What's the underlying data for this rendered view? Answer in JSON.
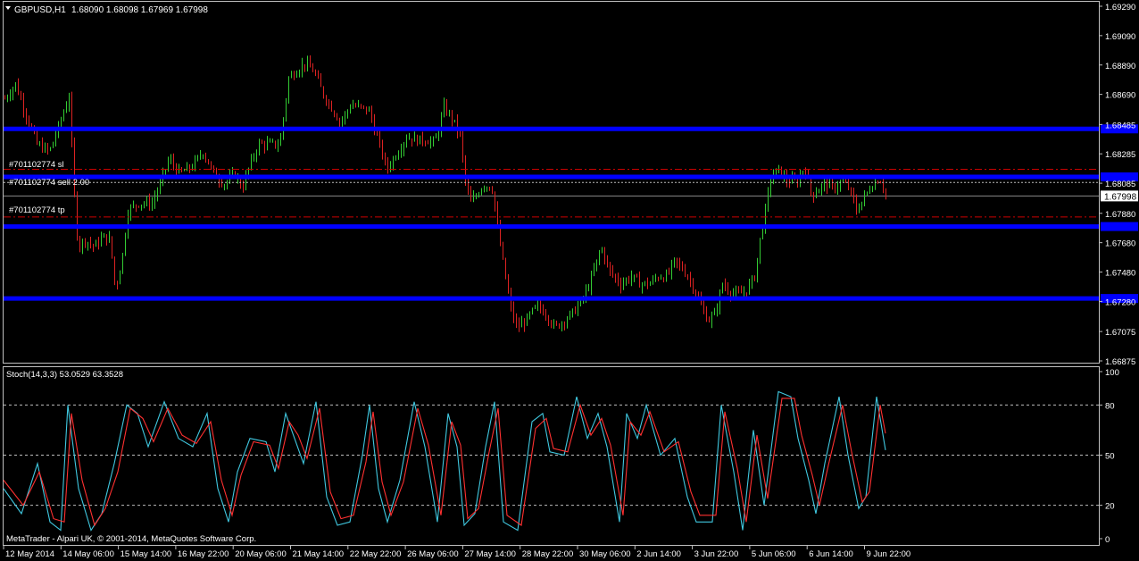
{
  "header": {
    "symbol": "GBPUSD,H1",
    "ohlc": "1.68090 1.68098 1.67969 1.67998",
    "dropdown_icon": "triangle-down-icon"
  },
  "colors": {
    "background": "#000000",
    "frame": "#c0c0c0",
    "bull": "#33cc33",
    "bear": "#dd2222",
    "level": "#0000ff",
    "trade": "#cc0000",
    "stoch_main": "#40c8e0",
    "stoch_signal": "#ff3030",
    "text": "#ffffff"
  },
  "price_axis": {
    "ticks": [
      "1.69290",
      "1.69090",
      "1.68890",
      "1.68690",
      "1.68485",
      "1.68285",
      "1.68085",
      "1.67880",
      "1.67680",
      "1.67480",
      "1.67280",
      "1.67075",
      "1.66875"
    ],
    "current_price": "1.67998"
  },
  "time_axis": {
    "labels": [
      "12 May 2014",
      "14 May 06:00",
      "15 May 14:00",
      "16 May 22:00",
      "20 May 06:00",
      "21 May 14:00",
      "22 May 22:00",
      "26 May 06:00",
      "27 May 14:00",
      "28 May 22:00",
      "30 May 06:00",
      "2 Jun 14:00",
      "3 Jun 22:00",
      "5 Jun 06:00",
      "6 Jun 14:00",
      "9 Jun 22:00"
    ]
  },
  "trade_labels": {
    "sl": "#701102774 sl",
    "sell": "#701102774 sell 2.00",
    "tp": "#701102774 tp"
  },
  "indicator": {
    "label": "Stoch(14,3,3) 53.0529 63.3528",
    "ticks": [
      "100",
      "80",
      "50",
      "20",
      "0"
    ]
  },
  "footer": {
    "copyright": "MetaTrader - Alpari UK, © 2001-2014, MetaQuotes Software Corp."
  },
  "chart_data": [
    {
      "type": "candlestick",
      "ylim": [
        1.66875,
        1.6929
      ],
      "horizontal_levels": [
        1.68455,
        1.68128,
        1.6779,
        1.673
      ],
      "trade_levels": {
        "sl": 1.6818,
        "sell": 1.6809,
        "tp": 1.67855
      },
      "close_path": [
        [
          0,
          1.6866
        ],
        [
          12,
          1.6876
        ],
        [
          24,
          1.6855
        ],
        [
          36,
          1.6835
        ],
        [
          50,
          1.683
        ],
        [
          62,
          1.685
        ],
        [
          72,
          1.6868
        ],
        [
          78,
          1.68
        ],
        [
          82,
          1.6765
        ],
        [
          90,
          1.677
        ],
        [
          100,
          1.6765
        ],
        [
          110,
          1.6772
        ],
        [
          118,
          1.677
        ],
        [
          124,
          1.6735
        ],
        [
          132,
          1.676
        ],
        [
          138,
          1.679
        ],
        [
          150,
          1.6795
        ],
        [
          165,
          1.6795
        ],
        [
          175,
          1.681
        ],
        [
          184,
          1.6825
        ],
        [
          196,
          1.6815
        ],
        [
          210,
          1.682
        ],
        [
          222,
          1.683
        ],
        [
          234,
          1.6815
        ],
        [
          246,
          1.6808
        ],
        [
          258,
          1.6815
        ],
        [
          266,
          1.6805
        ],
        [
          274,
          1.682
        ],
        [
          284,
          1.6835
        ],
        [
          296,
          1.6835
        ],
        [
          308,
          1.6835
        ],
        [
          318,
          1.688
        ],
        [
          326,
          1.6885
        ],
        [
          336,
          1.689
        ],
        [
          346,
          1.6885
        ],
        [
          356,
          1.687
        ],
        [
          366,
          1.686
        ],
        [
          376,
          1.685
        ],
        [
          388,
          1.6862
        ],
        [
          398,
          1.686
        ],
        [
          408,
          1.6858
        ],
        [
          418,
          1.6838
        ],
        [
          428,
          1.6818
        ],
        [
          438,
          1.6828
        ],
        [
          450,
          1.684
        ],
        [
          462,
          1.6838
        ],
        [
          472,
          1.6838
        ],
        [
          482,
          1.6836
        ],
        [
          492,
          1.686
        ],
        [
          502,
          1.6852
        ],
        [
          510,
          1.684
        ],
        [
          516,
          1.681
        ],
        [
          522,
          1.6795
        ],
        [
          528,
          1.68
        ],
        [
          536,
          1.6808
        ],
        [
          546,
          1.6805
        ],
        [
          554,
          1.677
        ],
        [
          562,
          1.674
        ],
        [
          568,
          1.672
        ],
        [
          574,
          1.671
        ],
        [
          584,
          1.6715
        ],
        [
          596,
          1.6725
        ],
        [
          606,
          1.672
        ],
        [
          616,
          1.671
        ],
        [
          626,
          1.6715
        ],
        [
          636,
          1.672
        ],
        [
          648,
          1.673
        ],
        [
          658,
          1.6745
        ],
        [
          668,
          1.6765
        ],
        [
          678,
          1.6748
        ],
        [
          690,
          1.674
        ],
        [
          702,
          1.6745
        ],
        [
          712,
          1.674
        ],
        [
          722,
          1.674
        ],
        [
          732,
          1.6745
        ],
        [
          742,
          1.6745
        ],
        [
          750,
          1.6755
        ],
        [
          760,
          1.675
        ],
        [
          770,
          1.674
        ],
        [
          780,
          1.6725
        ],
        [
          788,
          1.6715
        ],
        [
          796,
          1.672
        ],
        [
          804,
          1.674
        ],
        [
          812,
          1.6735
        ],
        [
          820,
          1.6732
        ],
        [
          830,
          1.6735
        ],
        [
          840,
          1.6745
        ],
        [
          846,
          1.677
        ],
        [
          852,
          1.679
        ],
        [
          858,
          1.6812
        ],
        [
          866,
          1.6818
        ],
        [
          876,
          1.681
        ],
        [
          888,
          1.681
        ],
        [
          896,
          1.682
        ],
        [
          904,
          1.68
        ],
        [
          912,
          1.6805
        ],
        [
          920,
          1.6808
        ],
        [
          928,
          1.6805
        ],
        [
          938,
          1.681
        ],
        [
          946,
          1.6805
        ],
        [
          954,
          1.679
        ],
        [
          962,
          1.6798
        ],
        [
          972,
          1.6808
        ],
        [
          980,
          1.6812
        ],
        [
          988,
          1.68
        ]
      ]
    },
    {
      "type": "line",
      "title": "Stoch(14,3,3)",
      "ylim": [
        0,
        100
      ],
      "levels": [
        80,
        50,
        20
      ],
      "series": [
        {
          "name": "main",
          "last": 53.0529,
          "points": [
            [
              0,
              30
            ],
            [
              20,
              15
            ],
            [
              38,
              45
            ],
            [
              52,
              10
            ],
            [
              64,
              5
            ],
            [
              72,
              80
            ],
            [
              84,
              30
            ],
            [
              98,
              5
            ],
            [
              110,
              15
            ],
            [
              124,
              45
            ],
            [
              138,
              80
            ],
            [
              150,
              75
            ],
            [
              162,
              55
            ],
            [
              180,
              82
            ],
            [
              196,
              60
            ],
            [
              212,
              55
            ],
            [
              228,
              75
            ],
            [
              240,
              30
            ],
            [
              252,
              10
            ],
            [
              262,
              40
            ],
            [
              276,
              60
            ],
            [
              294,
              58
            ],
            [
              304,
              40
            ],
            [
              316,
              75
            ],
            [
              326,
              60
            ],
            [
              336,
              45
            ],
            [
              350,
              82
            ],
            [
              362,
              25
            ],
            [
              374,
              8
            ],
            [
              388,
              10
            ],
            [
              402,
              50
            ],
            [
              410,
              80
            ],
            [
              420,
              30
            ],
            [
              430,
              10
            ],
            [
              444,
              35
            ],
            [
              460,
              82
            ],
            [
              472,
              55
            ],
            [
              486,
              10
            ],
            [
              498,
              75
            ],
            [
              508,
              55
            ],
            [
              516,
              8
            ],
            [
              528,
              15
            ],
            [
              540,
              55
            ],
            [
              550,
              82
            ],
            [
              560,
              10
            ],
            [
              576,
              5
            ],
            [
              592,
              70
            ],
            [
              604,
              75
            ],
            [
              612,
              52
            ],
            [
              628,
              50
            ],
            [
              642,
              85
            ],
            [
              654,
              60
            ],
            [
              666,
              75
            ],
            [
              676,
              55
            ],
            [
              690,
              10
            ],
            [
              698,
              75
            ],
            [
              710,
              60
            ],
            [
              720,
              80
            ],
            [
              736,
              50
            ],
            [
              752,
              60
            ],
            [
              766,
              25
            ],
            [
              776,
              10
            ],
            [
              794,
              10
            ],
            [
              804,
              80
            ],
            [
              818,
              40
            ],
            [
              828,
              5
            ],
            [
              840,
              65
            ],
            [
              852,
              20
            ],
            [
              868,
              88
            ],
            [
              882,
              85
            ],
            [
              890,
              60
            ],
            [
              902,
              35
            ],
            [
              910,
              15
            ],
            [
              920,
              45
            ],
            [
              936,
              85
            ],
            [
              946,
              50
            ],
            [
              958,
              18
            ],
            [
              966,
              25
            ],
            [
              978,
              85
            ],
            [
              988,
              53
            ]
          ]
        },
        {
          "name": "signal",
          "last": 63.3528,
          "points": [
            [
              0,
              35
            ],
            [
              22,
              20
            ],
            [
              40,
              40
            ],
            [
              56,
              12
            ],
            [
              68,
              10
            ],
            [
              76,
              75
            ],
            [
              88,
              35
            ],
            [
              102,
              8
            ],
            [
              114,
              18
            ],
            [
              128,
              40
            ],
            [
              142,
              78
            ],
            [
              156,
              72
            ],
            [
              168,
              58
            ],
            [
              184,
              78
            ],
            [
              200,
              62
            ],
            [
              216,
              57
            ],
            [
              232,
              70
            ],
            [
              244,
              35
            ],
            [
              256,
              14
            ],
            [
              266,
              38
            ],
            [
              280,
              58
            ],
            [
              298,
              56
            ],
            [
              308,
              42
            ],
            [
              320,
              70
            ],
            [
              330,
              62
            ],
            [
              340,
              48
            ],
            [
              354,
              78
            ],
            [
              366,
              28
            ],
            [
              378,
              12
            ],
            [
              392,
              14
            ],
            [
              406,
              46
            ],
            [
              414,
              76
            ],
            [
              424,
              34
            ],
            [
              434,
              14
            ],
            [
              448,
              34
            ],
            [
              464,
              78
            ],
            [
              476,
              56
            ],
            [
              490,
              14
            ],
            [
              502,
              70
            ],
            [
              512,
              56
            ],
            [
              520,
              12
            ],
            [
              532,
              18
            ],
            [
              544,
              52
            ],
            [
              554,
              78
            ],
            [
              564,
              14
            ],
            [
              580,
              8
            ],
            [
              596,
              66
            ],
            [
              608,
              72
            ],
            [
              616,
              54
            ],
            [
              632,
              52
            ],
            [
              646,
              80
            ],
            [
              658,
              62
            ],
            [
              670,
              72
            ],
            [
              680,
              56
            ],
            [
              694,
              14
            ],
            [
              702,
              70
            ],
            [
              714,
              62
            ],
            [
              724,
              76
            ],
            [
              740,
              52
            ],
            [
              756,
              58
            ],
            [
              770,
              28
            ],
            [
              780,
              14
            ],
            [
              798,
              14
            ],
            [
              808,
              76
            ],
            [
              822,
              42
            ],
            [
              832,
              10
            ],
            [
              844,
              62
            ],
            [
              856,
              24
            ],
            [
              872,
              84
            ],
            [
              886,
              84
            ],
            [
              894,
              62
            ],
            [
              906,
              38
            ],
            [
              914,
              20
            ],
            [
              924,
              44
            ],
            [
              940,
              80
            ],
            [
              950,
              52
            ],
            [
              962,
              22
            ],
            [
              970,
              28
            ],
            [
              982,
              80
            ],
            [
              988,
              63
            ]
          ]
        }
      ]
    }
  ]
}
